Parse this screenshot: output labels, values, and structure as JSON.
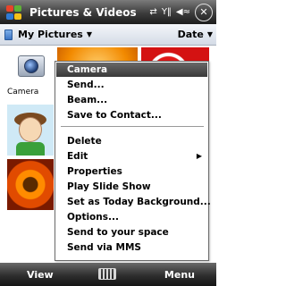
{
  "app": {
    "title": "Pictures & Videos",
    "close_label": "✕"
  },
  "status": {
    "sync_icon": "⇄",
    "signal_icon": "Y‖",
    "volume_icon": "◀≈"
  },
  "toolbar": {
    "folder": "My Pictures",
    "folder_caret": "▼",
    "sort": "Date",
    "sort_caret": "▼"
  },
  "thumbnails": {
    "camera_label": "Camera"
  },
  "menu": {
    "items": [
      {
        "label": "Camera",
        "selected": true
      },
      {
        "label": "Send..."
      },
      {
        "label": "Beam..."
      },
      {
        "label": "Save to Contact..."
      },
      {
        "label": "Delete"
      },
      {
        "label": "Edit",
        "submenu": true
      },
      {
        "label": "Properties"
      },
      {
        "label": "Play Slide Show"
      },
      {
        "label": "Set as Today Background..."
      },
      {
        "label": "Options..."
      },
      {
        "label": "Send to your space"
      },
      {
        "label": "Send via MMS"
      }
    ],
    "submenu_arrow": "▶"
  },
  "softkeys": {
    "left": "View",
    "right": "Menu"
  },
  "colors": {
    "selected_bg": "#4a4a4a",
    "bar_bg": "#2e2e2e"
  }
}
